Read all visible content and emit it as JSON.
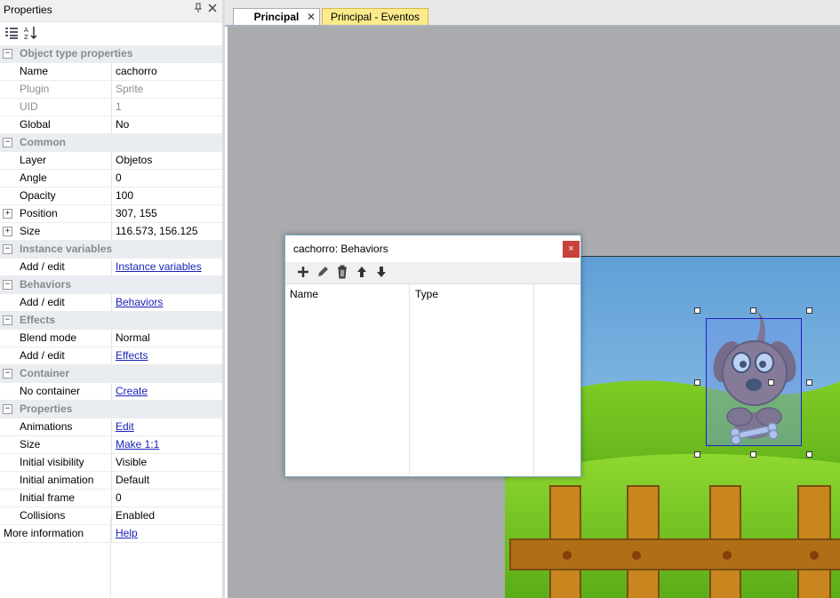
{
  "properties_panel": {
    "title": "Properties",
    "pin_icon": "pin-icon",
    "close_icon": "close-icon",
    "toolbar": {
      "categorized_icon": "categorized-icon",
      "sort_icon": "sort-az-icon"
    },
    "rows": [
      {
        "type": "cat",
        "label": "Object type properties",
        "expand": "⊟"
      },
      {
        "type": "prop",
        "label": "Name",
        "value": "cachorro"
      },
      {
        "type": "dis",
        "label": "Plugin",
        "value": "Sprite"
      },
      {
        "type": "dis",
        "label": "UID",
        "value": "1"
      },
      {
        "type": "prop",
        "label": "Global",
        "value": "No"
      },
      {
        "type": "cat",
        "label": "Common",
        "expand": "⊟"
      },
      {
        "type": "prop",
        "label": "Layer",
        "value": "Objetos"
      },
      {
        "type": "prop",
        "label": "Angle",
        "value": "0"
      },
      {
        "type": "prop",
        "label": "Opacity",
        "value": "100"
      },
      {
        "type": "expand",
        "label": "Position",
        "value": "307, 155"
      },
      {
        "type": "expand",
        "label": "Size",
        "value": "116.573, 156.125"
      },
      {
        "type": "cat",
        "label": "Instance variables"
      },
      {
        "type": "link",
        "label": "Add / edit",
        "value": "Instance variables"
      },
      {
        "type": "cat",
        "label": "Behaviors"
      },
      {
        "type": "link",
        "label": "Add / edit",
        "value": "Behaviors"
      },
      {
        "type": "cat",
        "label": "Effects"
      },
      {
        "type": "prop",
        "label": "Blend mode",
        "value": "Normal"
      },
      {
        "type": "link",
        "label": "Add / edit",
        "value": "Effects"
      },
      {
        "type": "cat",
        "label": "Container"
      },
      {
        "type": "link",
        "label": "No container",
        "value": "Create"
      },
      {
        "type": "cat",
        "label": "Properties"
      },
      {
        "type": "link",
        "label": "Animations",
        "value": "Edit"
      },
      {
        "type": "link",
        "label": "Size",
        "value": "Make 1:1"
      },
      {
        "type": "prop",
        "label": "Initial visibility",
        "value": "Visible"
      },
      {
        "type": "prop",
        "label": "Initial animation",
        "value": "Default"
      },
      {
        "type": "prop",
        "label": "Initial frame",
        "value": "0"
      },
      {
        "type": "prop",
        "label": "Collisions",
        "value": "Enabled"
      },
      {
        "type": "more",
        "label": "More information",
        "value": "Help"
      }
    ]
  },
  "tabs": {
    "active": "Principal",
    "active_close": "✕",
    "events": "Principal - Eventos"
  },
  "dialog": {
    "title": "cachorro: Behaviors",
    "close": "×",
    "toolbar": [
      "add-icon",
      "edit-icon",
      "delete-icon",
      "move-up-icon",
      "move-down-icon"
    ],
    "columns": [
      "Name",
      "Type"
    ]
  },
  "colors": {
    "canvas_bg": "#a9abae",
    "sky": "#7ab3e0",
    "hill": "#6cc21e",
    "fence": "#c9861e",
    "dialog_close": "#c7423a",
    "link": "#1a22b8"
  }
}
